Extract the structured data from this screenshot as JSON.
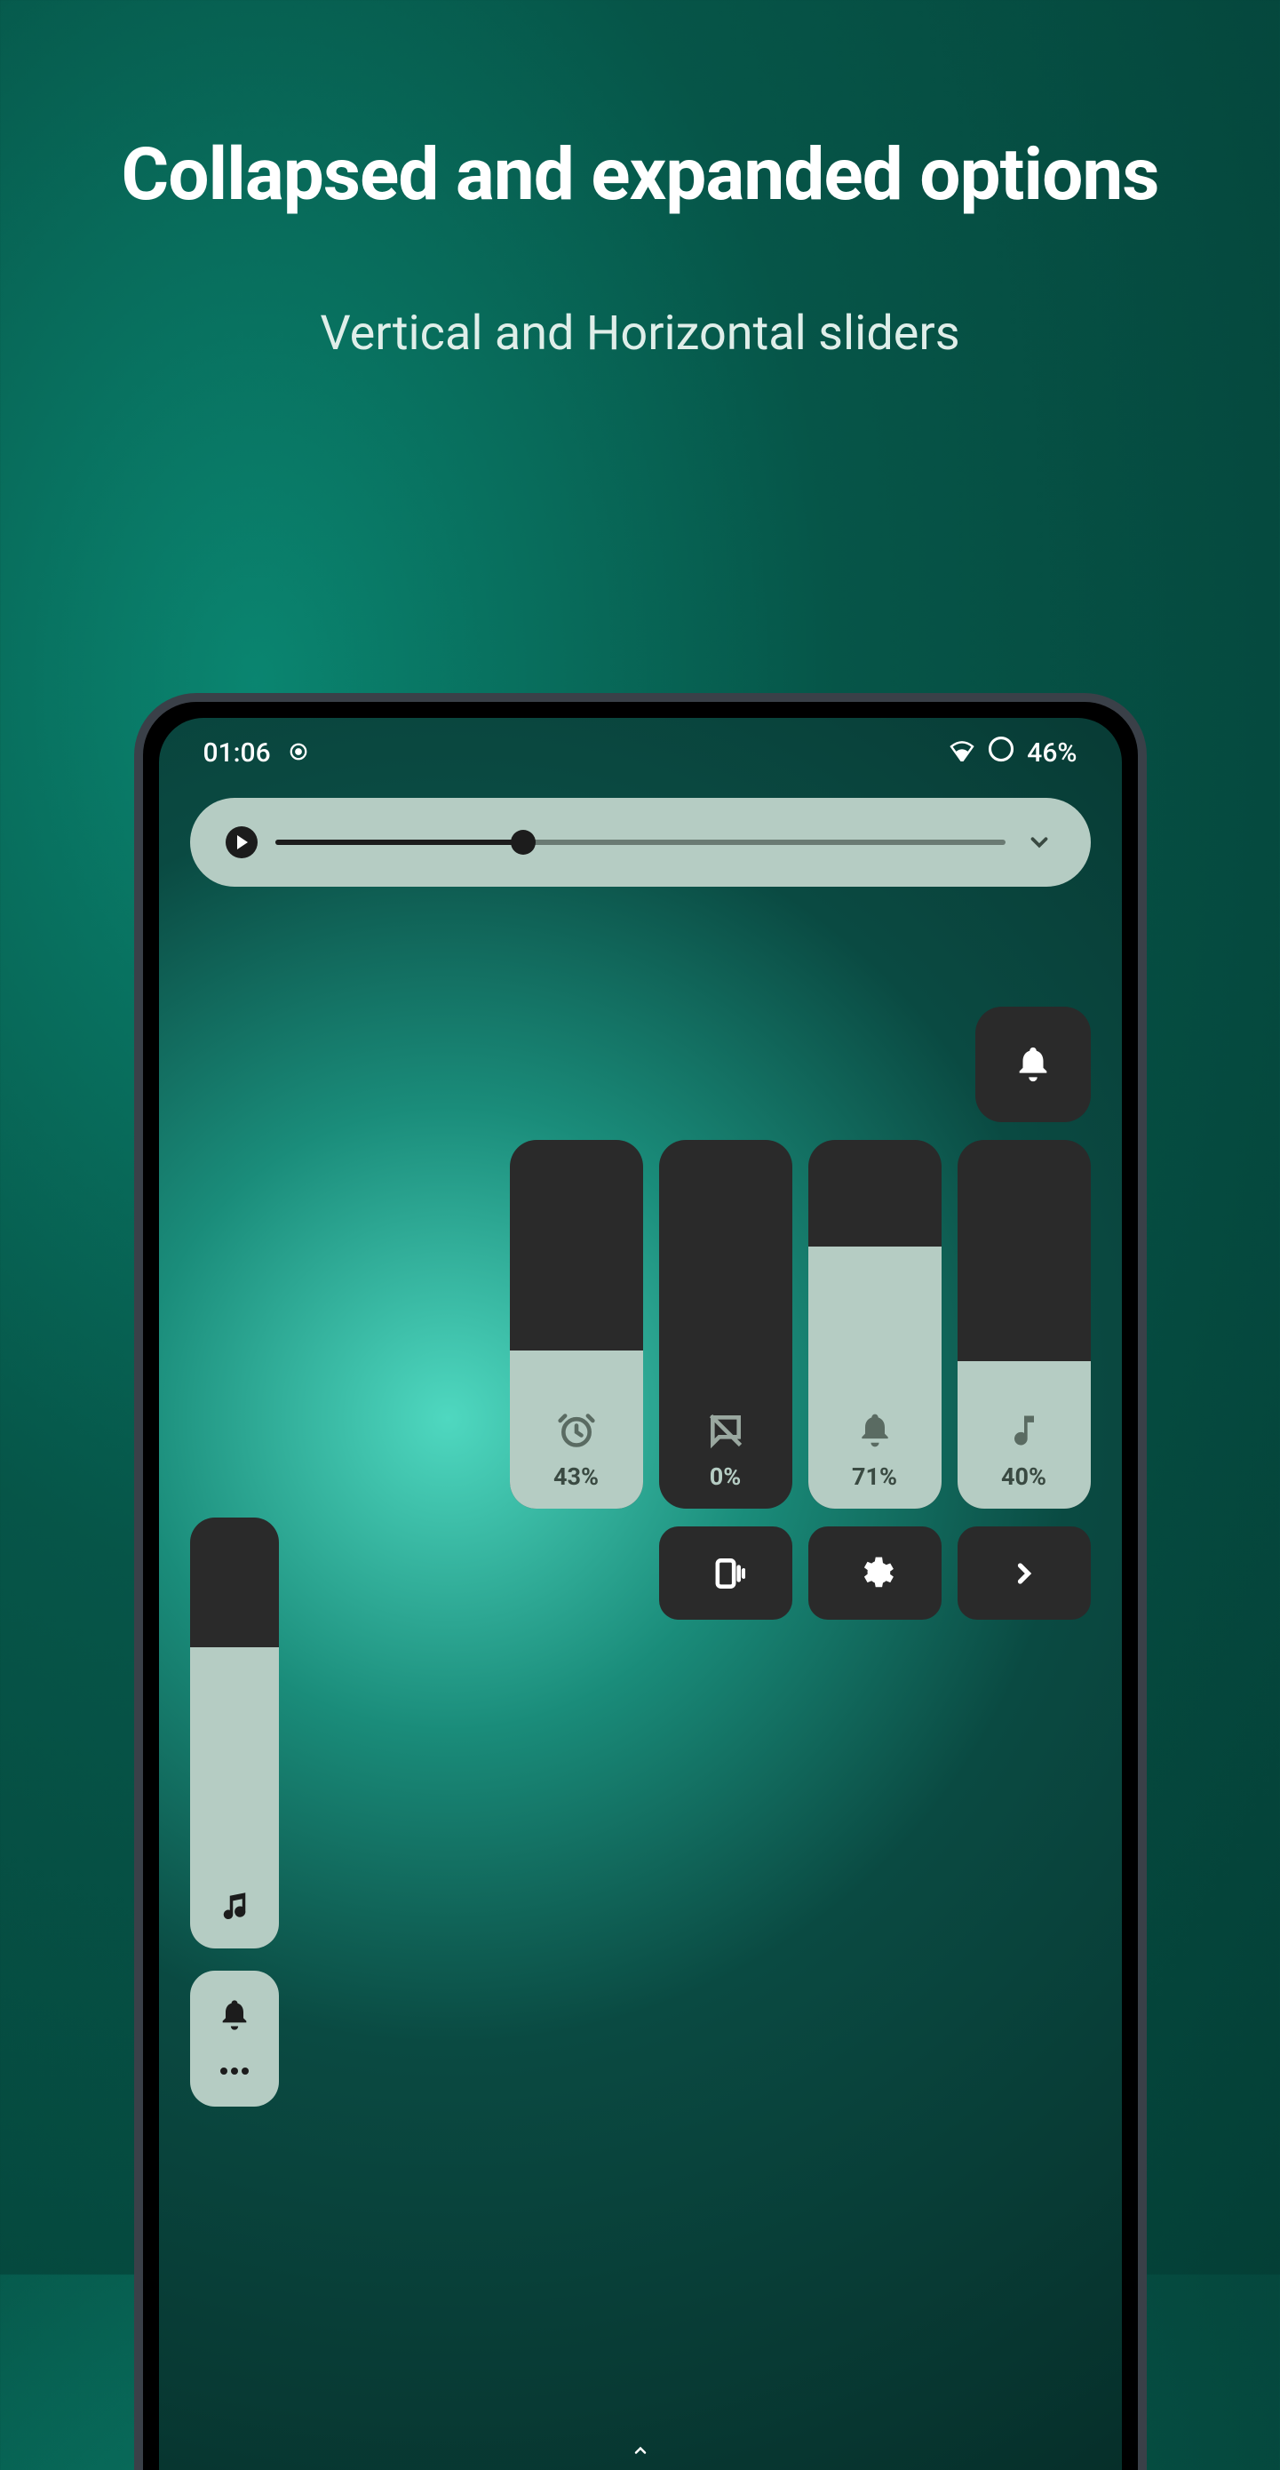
{
  "promo": {
    "title": "Collapsed and expanded options",
    "subtitle": "Vertical and Horizontal sliders"
  },
  "status_bar": {
    "time": "01:06",
    "battery_label": "46%"
  },
  "horizontal_slider": {
    "percent": 34
  },
  "vertical_sliders": [
    {
      "icon": "alarm-icon",
      "percent": 43,
      "label": "43%"
    },
    {
      "icon": "chat-off-icon",
      "percent": 0,
      "label": "0%"
    },
    {
      "icon": "bell-icon",
      "percent": 71,
      "label": "71%"
    },
    {
      "icon": "music-note-icon",
      "percent": 40,
      "label": "40%"
    }
  ],
  "action_buttons": [
    {
      "icon": "phone-vibrate-icon"
    },
    {
      "icon": "gear-icon"
    },
    {
      "icon": "chevron-right-icon"
    }
  ],
  "collapsed_slider": {
    "percent": 70,
    "icon": "music-note-icon"
  },
  "mini_panel": {
    "icons": [
      "bell-icon",
      "more-icon"
    ]
  },
  "colors": {
    "tile_dark": "#2a2a2a",
    "tile_light": "#b5ccc3"
  }
}
